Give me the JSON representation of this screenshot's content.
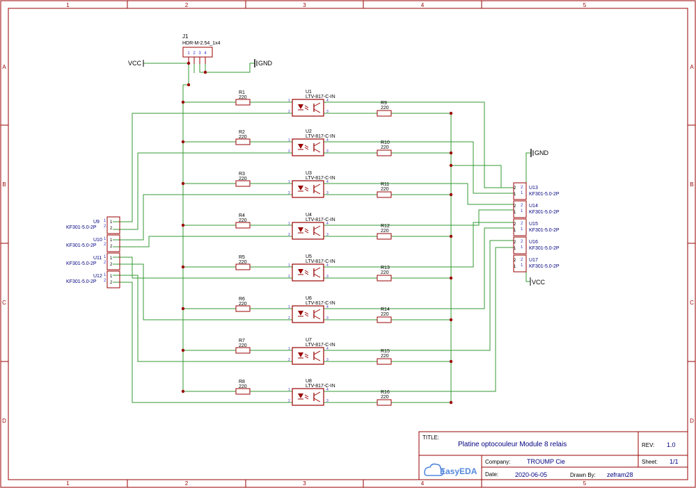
{
  "colors": {
    "wire": "#339933",
    "part": "#990000",
    "label": "#000080",
    "pin": "#3333cc",
    "frame": "#990000",
    "titleblock": "#000080",
    "ink": "#000000",
    "easyeda": "#5588dd"
  },
  "frame": {
    "columns": [
      "1",
      "2",
      "3",
      "4",
      "5"
    ],
    "rows": [
      "A",
      "B",
      "C",
      "D"
    ]
  },
  "header": {
    "ref": "J1",
    "value": "HDR-M-2.54_1x4",
    "pins": [
      "1",
      "2",
      "3",
      "4"
    ],
    "vcc": "VCC",
    "gnd": "GND"
  },
  "channels": [
    {
      "r_in": "R1",
      "r_in_val": "220",
      "opto": "U1",
      "opto_val": "LTV-817-C-IN",
      "r_out": "R9",
      "r_out_val": "220"
    },
    {
      "r_in": "R2",
      "r_in_val": "220",
      "opto": "U2",
      "opto_val": "LTV-817-C-IN",
      "r_out": "R10",
      "r_out_val": "220"
    },
    {
      "r_in": "R3",
      "r_in_val": "220",
      "opto": "U3",
      "opto_val": "LTV-817-C-IN",
      "r_out": "R11",
      "r_out_val": "220"
    },
    {
      "r_in": "R4",
      "r_in_val": "220",
      "opto": "U4",
      "opto_val": "LTV-817-C-IN",
      "r_out": "R12",
      "r_out_val": "220"
    },
    {
      "r_in": "R5",
      "r_in_val": "220",
      "opto": "U5",
      "opto_val": "LTV-817-C-IN",
      "r_out": "R13",
      "r_out_val": "220"
    },
    {
      "r_in": "R6",
      "r_in_val": "220",
      "opto": "U6",
      "opto_val": "LTV-817-C-IN",
      "r_out": "R14",
      "r_out_val": "220"
    },
    {
      "r_in": "R7",
      "r_in_val": "220",
      "opto": "U7",
      "opto_val": "LTV-817-C-IN",
      "r_out": "R15",
      "r_out_val": "220"
    },
    {
      "r_in": "R8",
      "r_in_val": "220",
      "opto": "U8",
      "opto_val": "LTV-817-C-IN",
      "r_out": "R16",
      "r_out_val": "220"
    }
  ],
  "left_terminals": [
    {
      "ref": "U9",
      "value": "KF301-5.0-2P"
    },
    {
      "ref": "U10",
      "value": "KF301-5.0-2P"
    },
    {
      "ref": "U11",
      "value": "KF301-5.0-2P"
    },
    {
      "ref": "U12",
      "value": "KF301-5.0-2P"
    }
  ],
  "right_terminals": [
    {
      "ref": "U13",
      "value": "KF301-5.0-2P"
    },
    {
      "ref": "U14",
      "value": "KF301-5.0-2P"
    },
    {
      "ref": "U15",
      "value": "KF301-5.0-2P"
    },
    {
      "ref": "U16",
      "value": "KF301-5.0-2P"
    },
    {
      "ref": "U17",
      "value": "KF301-5.0-2P"
    }
  ],
  "right_power": {
    "gnd": "GND",
    "vcc": "VCC"
  },
  "title_block": {
    "title_label": "TITLE:",
    "title": "Platine optocouleur Module 8 relais",
    "rev_label": "REV:",
    "rev": "1.0",
    "company_label": "Company:",
    "company": "TROUMP Cie",
    "sheet_label": "Sheet:",
    "sheet": "1/1",
    "date_label": "Date:",
    "date": "2020-06-05",
    "drawn_label": "Drawn By:",
    "drawn": "zefram28",
    "brand": "EasyEDA"
  }
}
